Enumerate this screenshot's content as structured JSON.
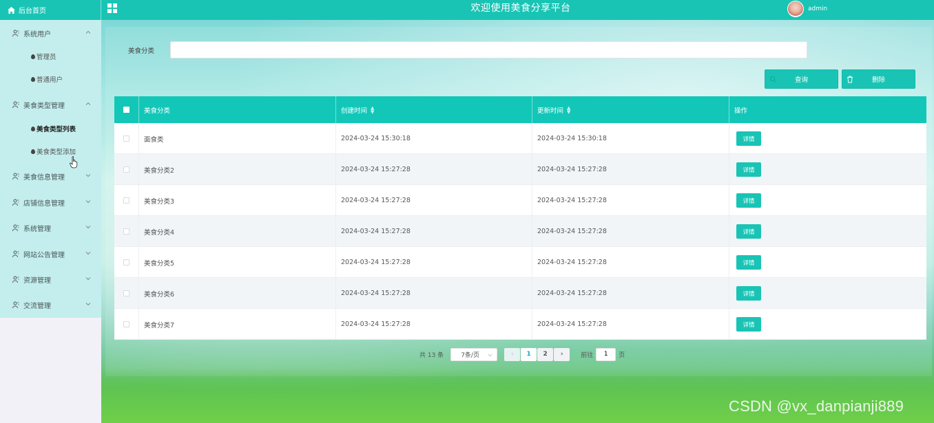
{
  "header": {
    "home_label": "后台首页",
    "title": "欢迎使用美食分享平台",
    "username": "admin"
  },
  "sidebar": {
    "items": [
      {
        "label": "系统用户",
        "expanded": true,
        "children": [
          "管理员",
          "普通用户"
        ]
      },
      {
        "label": "美食类型管理",
        "expanded": true,
        "children": [
          "美食类型列表",
          "美食类型添加"
        ],
        "active_child": 0
      },
      {
        "label": "美食信息管理",
        "expanded": false
      },
      {
        "label": "店铺信息管理",
        "expanded": false
      },
      {
        "label": "系统管理",
        "expanded": false
      },
      {
        "label": "网站公告管理",
        "expanded": false
      },
      {
        "label": "资源管理",
        "expanded": false
      },
      {
        "label": "交流管理",
        "expanded": false
      }
    ]
  },
  "search": {
    "label": "美食分类",
    "value": "",
    "query_label": "查询",
    "delete_label": "删除"
  },
  "table": {
    "columns": [
      "美食分类",
      "创建时间",
      "更新时间",
      "操作"
    ],
    "rows": [
      {
        "category": "面食类",
        "created": "2024-03-24 15:30:18",
        "updated": "2024-03-24 15:30:18",
        "action": "详情"
      },
      {
        "category": "美食分类2",
        "created": "2024-03-24 15:27:28",
        "updated": "2024-03-24 15:27:28",
        "action": "详情"
      },
      {
        "category": "美食分类3",
        "created": "2024-03-24 15:27:28",
        "updated": "2024-03-24 15:27:28",
        "action": "详情"
      },
      {
        "category": "美食分类4",
        "created": "2024-03-24 15:27:28",
        "updated": "2024-03-24 15:27:28",
        "action": "详情"
      },
      {
        "category": "美食分类5",
        "created": "2024-03-24 15:27:28",
        "updated": "2024-03-24 15:27:28",
        "action": "详情"
      },
      {
        "category": "美食分类6",
        "created": "2024-03-24 15:27:28",
        "updated": "2024-03-24 15:27:28",
        "action": "详情"
      },
      {
        "category": "美食分类7",
        "created": "2024-03-24 15:27:28",
        "updated": "2024-03-24 15:27:28",
        "action": "详情"
      }
    ]
  },
  "pagination": {
    "total": "共 13 条",
    "page_size": "7条/页",
    "prev": "‹",
    "pages": [
      "1",
      "2"
    ],
    "current_page": "1",
    "next": "›",
    "goto_label": "前往",
    "goto_value": "1",
    "page_suffix": "页"
  },
  "watermark": "CSDN @vx_danpianji889",
  "colors": {
    "accent": "#19c4b5",
    "sidebar_bg": "#c3eeed"
  },
  "icons": {
    "home": "house-icon",
    "menu_toggle": "grid-icon",
    "menu_group": "person-icon",
    "query": "search-icon",
    "delete": "trash-icon"
  }
}
